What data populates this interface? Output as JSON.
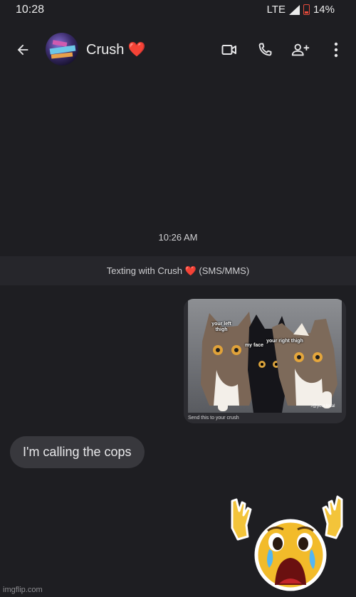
{
  "status_bar": {
    "time": "10:28",
    "network": "LTE",
    "battery": "14%"
  },
  "header": {
    "contact_name": "Crush ❤️"
  },
  "conversation": {
    "timestamp": "10:26 AM",
    "info_banner": "Texting with Crush ❤️ (SMS/MMS)",
    "mms": {
      "labels": {
        "left": "your left thigh",
        "middle": "my face",
        "right": "your right thigh"
      },
      "handle": "♪@your.local",
      "caption": "Send this to your crush"
    },
    "incoming_message": "I'm calling the cops"
  },
  "watermark": "imgflip.com",
  "colors": {
    "background": "#1e1e22",
    "incoming_bubble": "#38383d",
    "battery_low": "#e84b3b"
  },
  "icons": [
    "back-arrow-icon",
    "video-call-icon",
    "phone-icon",
    "add-person-icon",
    "more-vert-icon",
    "signal-icon",
    "battery-icon",
    "crying-emoji-icon"
  ]
}
